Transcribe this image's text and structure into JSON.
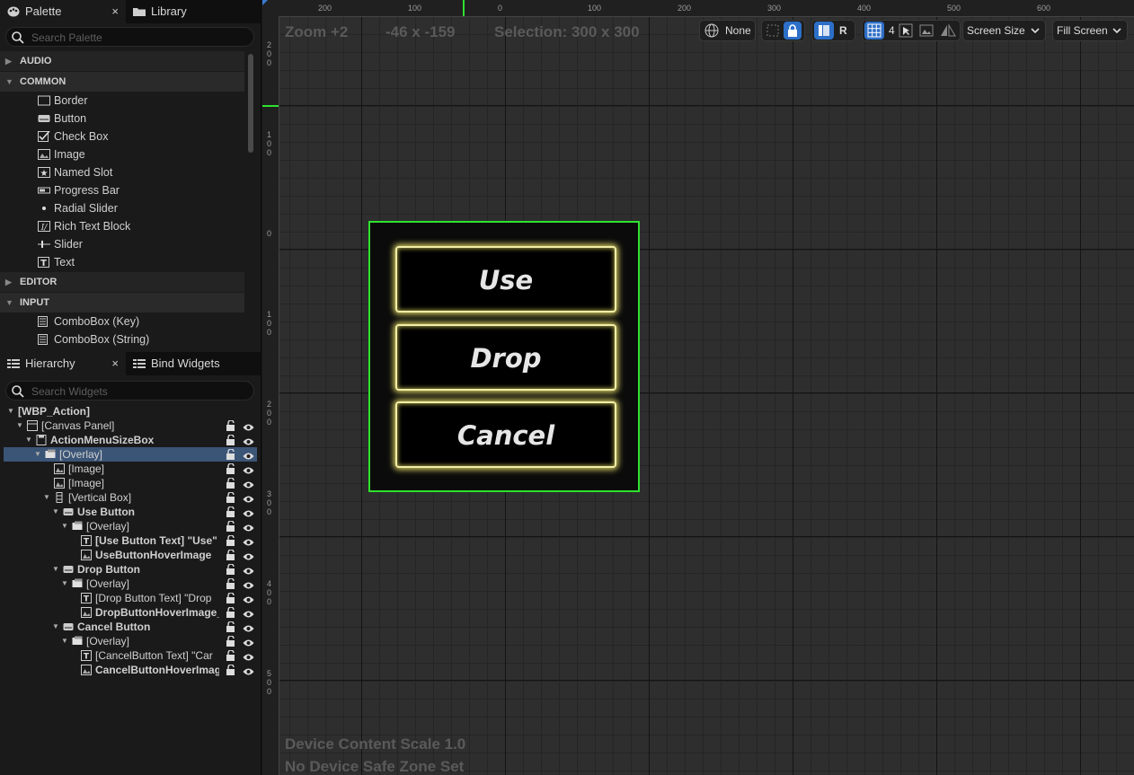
{
  "palette": {
    "tab_label": "Palette",
    "close": "×",
    "library_tab": "Library",
    "search_placeholder": "Search Palette",
    "categories": {
      "audio": "AUDIO",
      "common": "COMMON",
      "editor": "EDITOR",
      "input": "INPUT"
    },
    "common_items": [
      "Border",
      "Button",
      "Check Box",
      "Image",
      "Named Slot",
      "Progress Bar",
      "Radial Slider",
      "Rich Text Block",
      "Slider",
      "Text"
    ],
    "input_items": [
      "ComboBox (Key)",
      "ComboBox (String)"
    ]
  },
  "hierarchy": {
    "tab_label": "Hierarchy",
    "close": "×",
    "bind_tab": "Bind Widgets",
    "search_placeholder": "Search Widgets",
    "rows": [
      "[WBP_Action]",
      "[Canvas Panel]",
      "ActionMenuSizeBox",
      "[Overlay]",
      "[Image]",
      "[Image]",
      "[Vertical Box]",
      "Use Button",
      "[Overlay]",
      "[Use Button Text] \"Use\"",
      "UseButtonHoverImage",
      "Drop Button",
      "[Overlay]",
      "[Drop Button Text] \"Drop",
      "DropButtonHoverImage_",
      "Cancel Button",
      "[Overlay]",
      "[CancelButton Text] \"Car",
      "CancelButtonHoverImag"
    ]
  },
  "designer": {
    "zoom": "Zoom +2",
    "cursor": "-46 x -159",
    "selection": "Selection: 300 x 300",
    "device_scale": "Device Content Scale 1.0",
    "safe_zone": "No Device Safe Zone Set",
    "toolbar": {
      "localization": "None",
      "respect_locks": "R",
      "grid_snap": "4",
      "screen_size": "Screen Size",
      "fill_screen": "Fill Screen"
    },
    "ruler_top": [
      "200",
      "100",
      "0",
      "100",
      "200",
      "300",
      "400",
      "500",
      "600"
    ],
    "ruler_left": [
      "2\n0\n0",
      "1\n0\n0",
      "0",
      "1\n0\n0",
      "2\n0\n0",
      "3\n0\n0",
      "4\n0\n0",
      "5\n0\n0"
    ]
  },
  "menu": {
    "buttons": [
      "Use",
      "Drop",
      "Cancel"
    ],
    "glow_color": "#f2eda8",
    "selection_color": "#2ee22e"
  }
}
